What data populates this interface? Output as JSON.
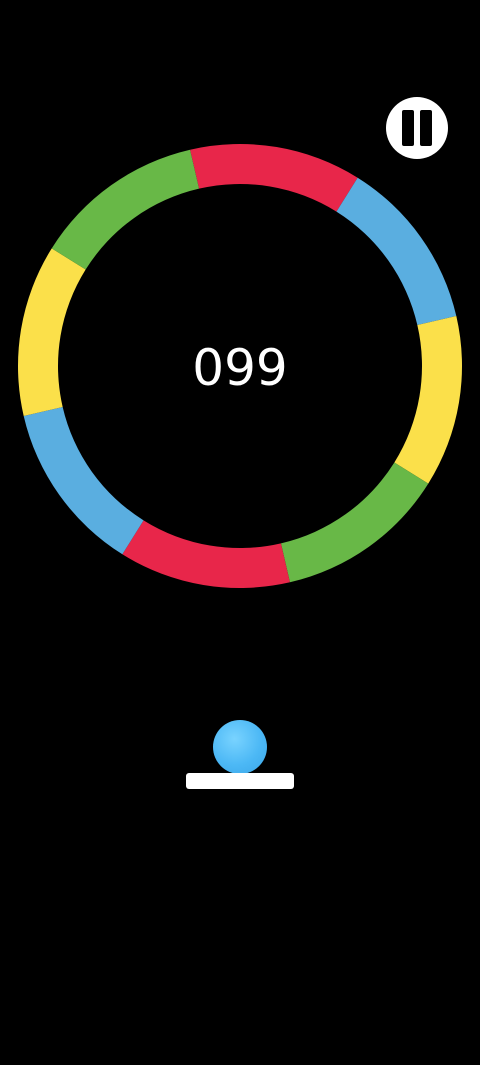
{
  "hud": {
    "score": "099",
    "pause_icon": "pause-icon"
  },
  "ring": {
    "segment_colors": [
      "#e8264a",
      "#5aaee0",
      "#fbe04a",
      "#68b847",
      "#e8264a",
      "#5aaee0",
      "#fbe04a",
      "#68b847"
    ],
    "rotation_deg": -13
  },
  "colors": {
    "background": "#000000",
    "ball": "#4cb8f5",
    "platform": "#ffffff",
    "red": "#e8264a",
    "blue": "#5aaee0",
    "yellow": "#fbe04a",
    "green": "#68b847"
  }
}
